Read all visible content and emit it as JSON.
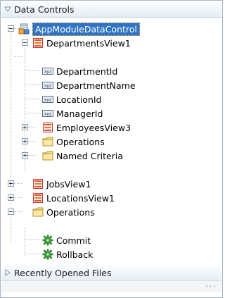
{
  "panel": {
    "header_title": "Data Controls",
    "footer_title": "Recently Opened Files",
    "scroll_hint": "‹‹‹"
  },
  "tree": {
    "root": "AppModuleDataControl",
    "departments_view": "DepartmentsView1",
    "attr_department_id": "DepartmentId",
    "attr_department_name": "DepartmentName",
    "attr_location_id": "LocationId",
    "attr_manager_id": "ManagerId",
    "employees_view": "EmployeesView3",
    "dept_operations": "Operations",
    "named_criteria": "Named Criteria",
    "jobs_view": "JobsView1",
    "locations_view": "LocationsView1",
    "root_operations": "Operations",
    "commit": "Commit",
    "rollback": "Rollback"
  },
  "icons": {
    "attribute_badge": "xyz"
  }
}
